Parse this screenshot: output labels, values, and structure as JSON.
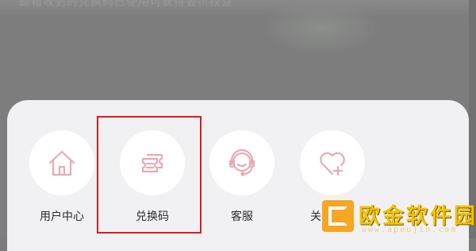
{
  "background": {
    "obscured_text": "邮箱收到的兑换码已使用可获得会员权益"
  },
  "actions": [
    {
      "id": "user-center",
      "label": "用户中心",
      "icon": "house-icon"
    },
    {
      "id": "redeem-code",
      "label": "兑换码",
      "icon": "ticket-icon"
    },
    {
      "id": "customer-service",
      "label": "客服",
      "icon": "headset-icon"
    },
    {
      "id": "follow-us",
      "label": "关注我们",
      "icon": "heart-plus-icon"
    }
  ],
  "highlighted_action": "redeem-code",
  "colors": {
    "icon_pink": "#e8aab3",
    "highlight_red": "#e2191c",
    "sheet_bg": "#f1f1f3",
    "watermark_gold": "#f3c200",
    "watermark_orange": "#f5a623"
  },
  "watermark": {
    "title": "欧金软件园",
    "url": "www.apoujin.com"
  }
}
